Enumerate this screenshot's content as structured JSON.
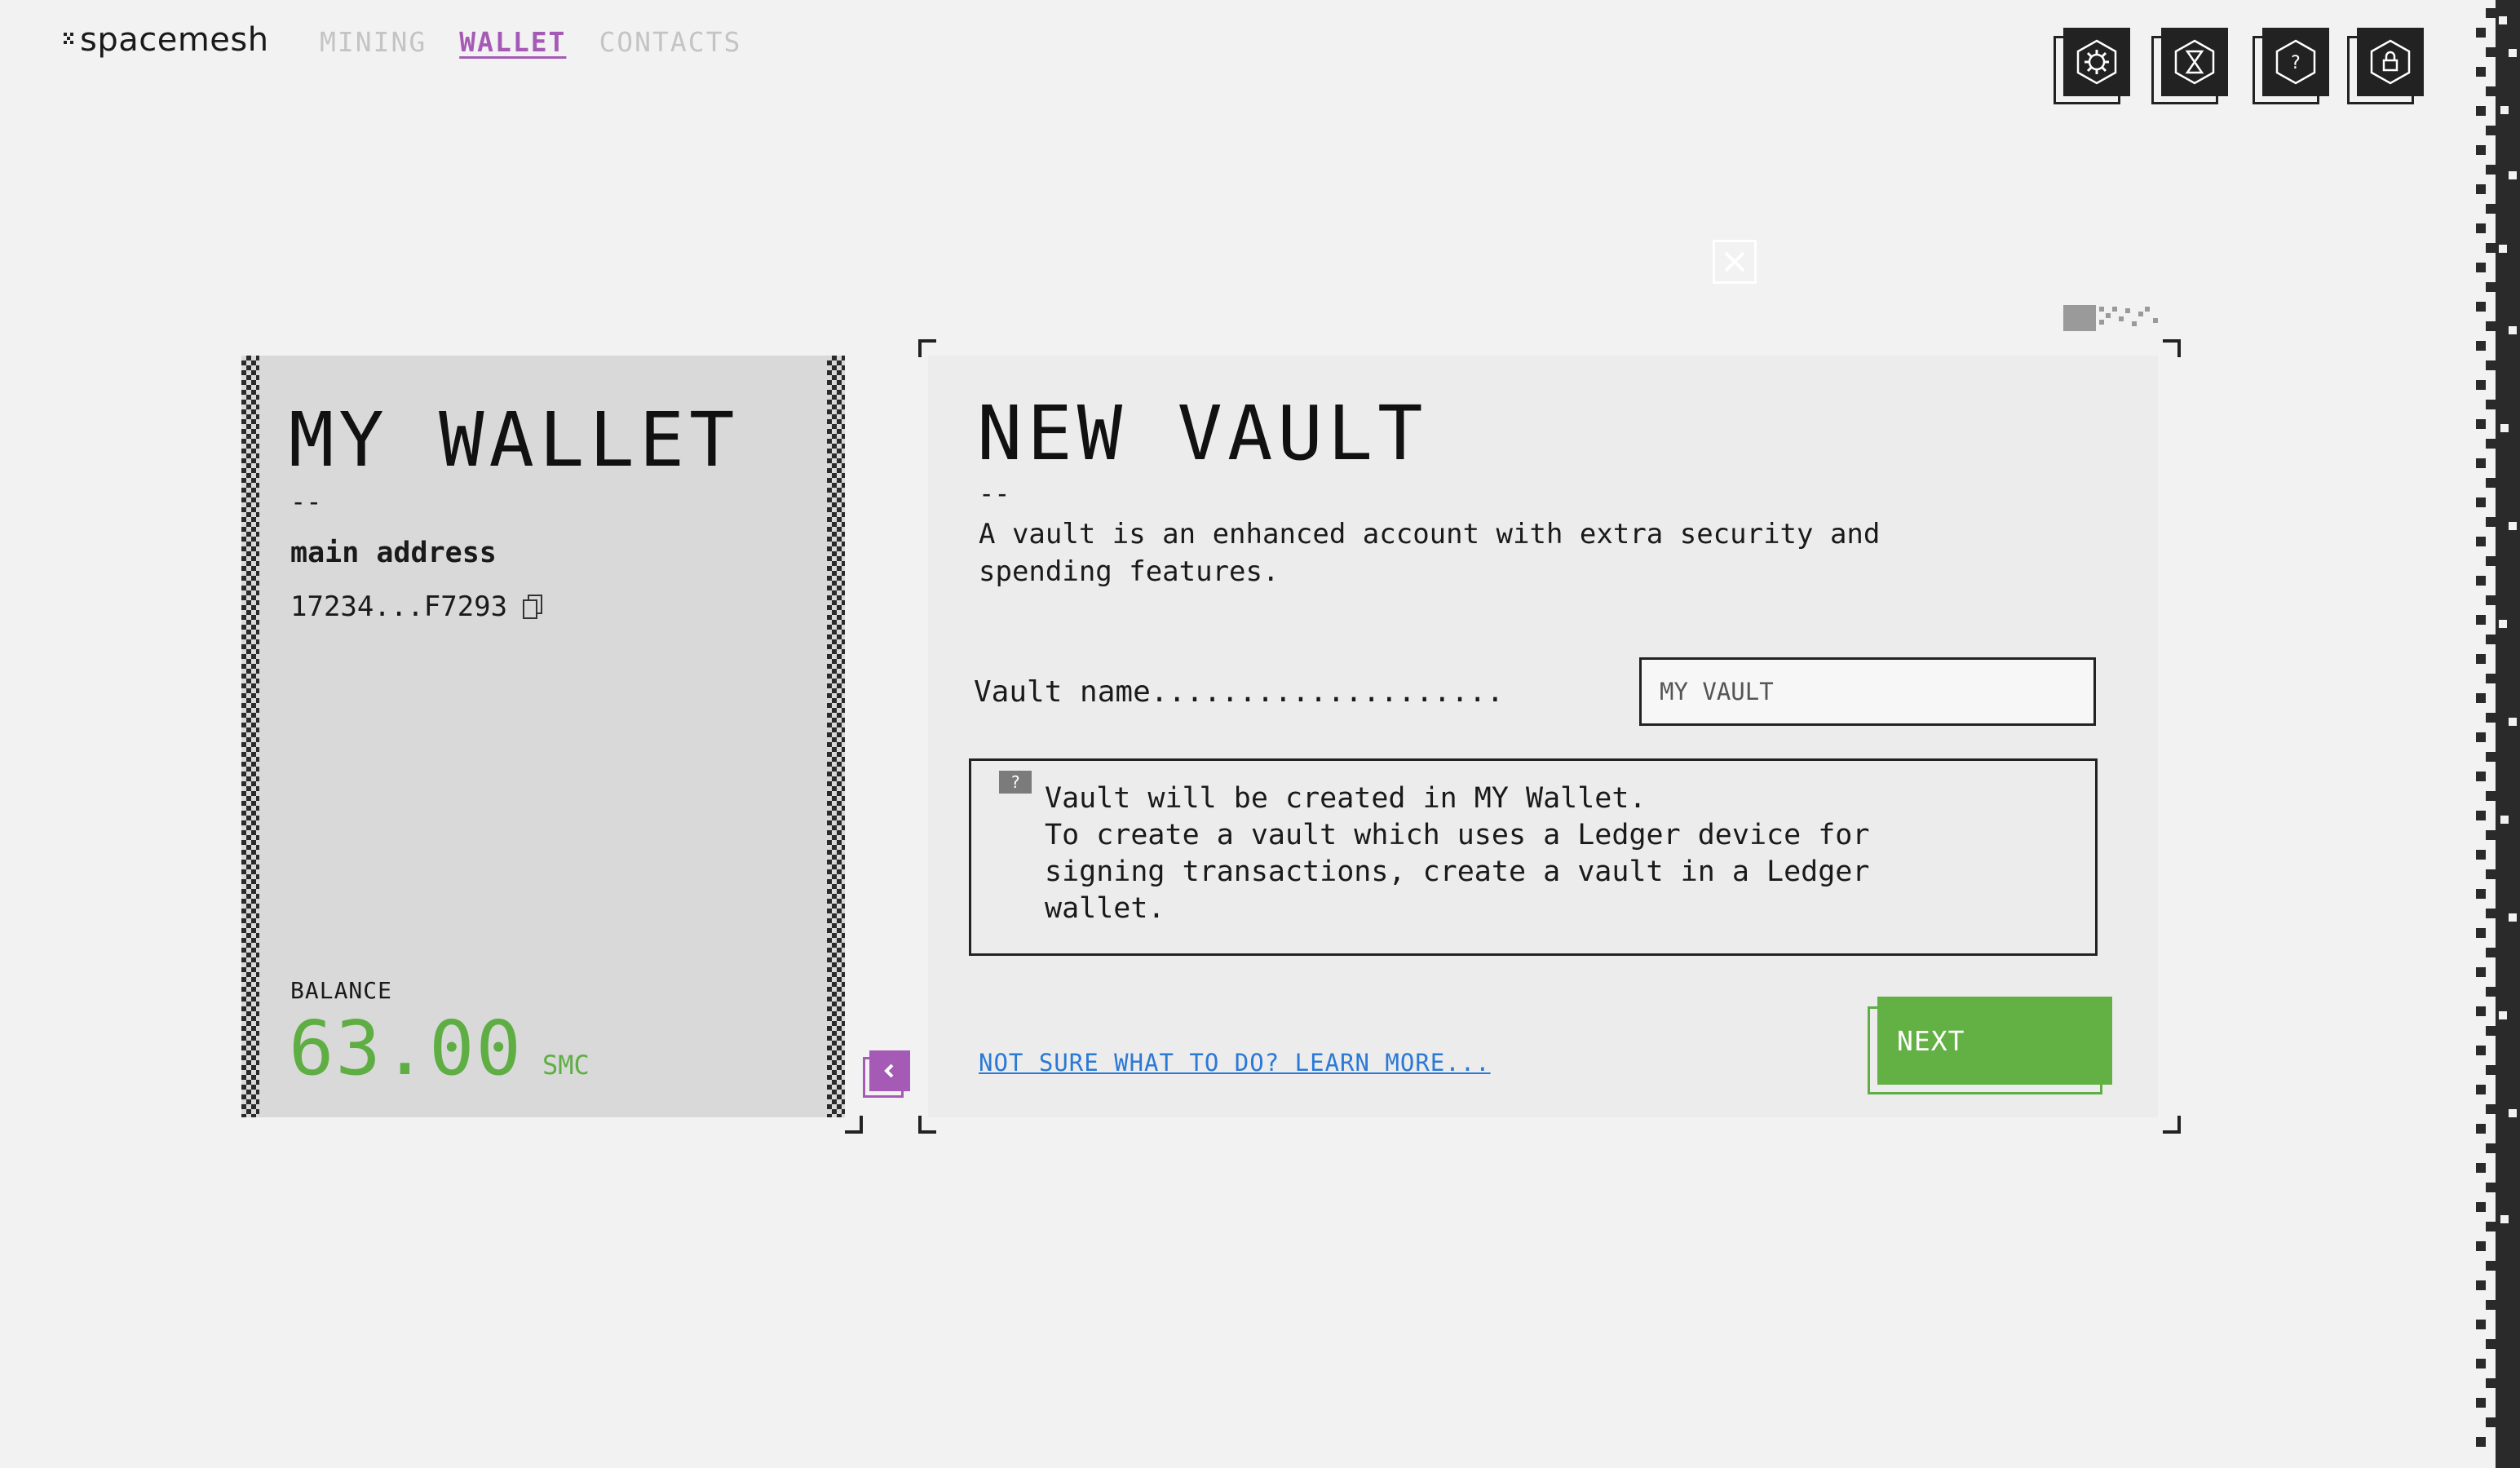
{
  "app": {
    "logo_text": "spacemesh"
  },
  "nav": {
    "items": [
      {
        "label": "MINING",
        "active": false
      },
      {
        "label": "WALLET",
        "active": true
      },
      {
        "label": "CONTACTS",
        "active": false
      }
    ]
  },
  "top_icons": [
    {
      "icon": "settings-icon"
    },
    {
      "icon": "network-icon"
    },
    {
      "icon": "help-icon"
    },
    {
      "icon": "lock-icon"
    }
  ],
  "wallet": {
    "title": "MY WALLET",
    "dash": "--",
    "address_label": "main address",
    "address": "17234...F7293",
    "balance_label": "BALANCE",
    "balance": "63.00",
    "unit": "SMC"
  },
  "vault": {
    "title": "NEW VAULT",
    "dash": "--",
    "description": "A vault is an enhanced account with extra security and spending features.",
    "name_label": "Vault name....................",
    "name_placeholder": "MY VAULT",
    "info_badge": "?",
    "info_text": "Vault will be created in MY Wallet.\nTo create a vault which uses a Ledger device for\nsigning transactions, create a vault in a Ledger\nwallet.",
    "learn_more": "NOT SURE WHAT TO DO? LEARN MORE...",
    "next_label": "NEXT"
  },
  "colors": {
    "accent": "#a55bb5",
    "green": "#63b145",
    "link": "#2b79d6",
    "dark": "#222222",
    "background": "#f2f2f2"
  }
}
